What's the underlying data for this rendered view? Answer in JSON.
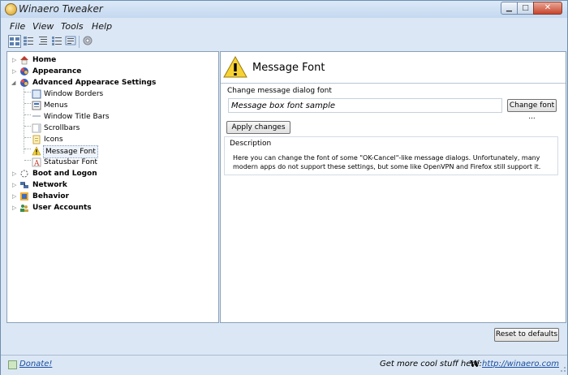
{
  "window": {
    "title": "Winaero Tweaker"
  },
  "menu": {
    "items": [
      "File",
      "View",
      "Tools",
      "Help"
    ]
  },
  "toolbar": {
    "icons": [
      "view-large-icon",
      "view-details-icon",
      "collapse-icon",
      "expand-icon",
      "list-icon",
      "gear-icon"
    ]
  },
  "tree": {
    "items": [
      {
        "label": "Home",
        "bold": true,
        "level": 0,
        "icon": "home-icon"
      },
      {
        "label": "Appearance",
        "bold": true,
        "level": 0,
        "icon": "appearance-icon"
      },
      {
        "label": "Advanced Appearace Settings",
        "bold": true,
        "level": 0,
        "icon": "advanced-appearance-icon",
        "expanded": true
      },
      {
        "label": "Window Borders",
        "bold": false,
        "level": 1,
        "icon": "window-borders-icon"
      },
      {
        "label": "Menus",
        "bold": false,
        "level": 1,
        "icon": "menus-icon"
      },
      {
        "label": "Window Title Bars",
        "bold": false,
        "level": 1,
        "icon": "window-title-bars-icon"
      },
      {
        "label": "Scrollbars",
        "bold": false,
        "level": 1,
        "icon": "scrollbars-icon"
      },
      {
        "label": "Icons",
        "bold": false,
        "level": 1,
        "icon": "icons-icon"
      },
      {
        "label": "Message Font",
        "bold": false,
        "level": 1,
        "icon": "warning-icon",
        "selected": true
      },
      {
        "label": "Statusbar Font",
        "bold": false,
        "level": 1,
        "icon": "font-icon"
      },
      {
        "label": "Boot and Logon",
        "bold": true,
        "level": 0,
        "icon": "boot-icon"
      },
      {
        "label": "Network",
        "bold": true,
        "level": 0,
        "icon": "network-icon"
      },
      {
        "label": "Behavior",
        "bold": true,
        "level": 0,
        "icon": "behavior-icon"
      },
      {
        "label": "User Accounts",
        "bold": true,
        "level": 0,
        "icon": "user-accounts-icon"
      }
    ]
  },
  "page": {
    "title": "Message Font",
    "group_label": "Change message dialog font",
    "font_sample": "Message box font sample",
    "change_font_button": "Change font ...",
    "apply_button": "Apply changes",
    "description_label": "Description",
    "description_text": "Here you can change the font of some \"OK-Cancel\"-like message dialogs. Unfortunately, many modern apps do not support these settings, but some like OpenVPN and Firefox still support it."
  },
  "footer": {
    "reset_button": "Reset to defaults",
    "donate": "Donate!",
    "more_text": "Get more cool stuff here:",
    "site": "http://winaero.com"
  },
  "colors": {
    "accent": "#1a4ea0",
    "frame": "#dbe7f5"
  }
}
